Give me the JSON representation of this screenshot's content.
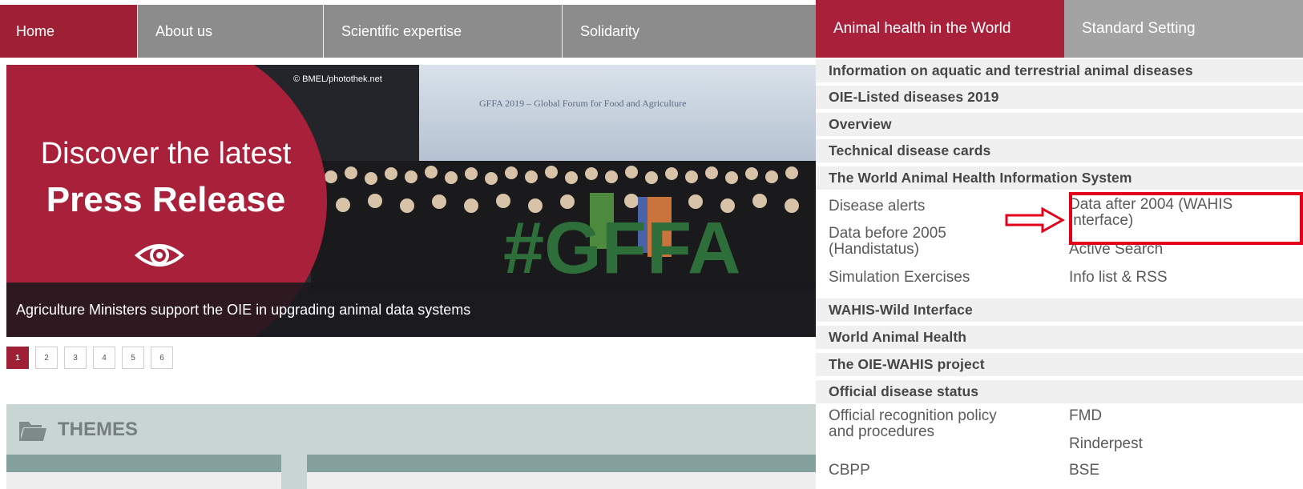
{
  "nav": {
    "items": [
      "Home",
      "About us",
      "Scientific expertise",
      "Solidarity"
    ],
    "active_index": 0
  },
  "hero": {
    "photo_credit": "© BMEL/photothek.net",
    "banner_text": "GFFA 2019 – Global Forum for Food and Agriculture",
    "hashtag": "#GFFA",
    "promo_line1": "Discover the latest",
    "promo_line2": "Press Release",
    "caption": "Agriculture Ministers support the OIE in upgrading animal data systems"
  },
  "pager": {
    "pages": [
      "1",
      "2",
      "3",
      "4",
      "5",
      "6"
    ],
    "active_index": 0
  },
  "themes": {
    "title": "THEMES"
  },
  "right_panel": {
    "tabs": [
      "Animal health in the World",
      "Standard Setting"
    ],
    "rows": {
      "info": "Information on aquatic and terrestrial animal diseases",
      "listed": "OIE-Listed diseases 2019",
      "overview": "Overview",
      "cards": "Technical disease cards",
      "wahis": "The World Animal Health Information System",
      "wild": "WAHIS-Wild Interface",
      "world": "World Animal Health",
      "project": "The OIE-WAHIS project",
      "status": "Official disease status"
    },
    "links": {
      "disease_alerts": "Disease alerts",
      "data_before_1": "Data before 2005",
      "data_before_2": "(Handistatus)",
      "data_after_1": "Data after 2004 (WAHIS",
      "data_after_2": "Interface)",
      "active_search": "Active Search",
      "simulation": "Simulation Exercises",
      "info_list": "Info list & RSS",
      "recognition_1": "Official recognition policy",
      "recognition_2": "and procedures",
      "fmd": "FMD",
      "rinderpest": "Rinderpest",
      "cbpp": "CBPP",
      "bse": "BSE"
    }
  },
  "colors": {
    "brand_red": "#a8203a",
    "callout_red": "#e2001a",
    "nav_gray": "#8c8c8c"
  }
}
